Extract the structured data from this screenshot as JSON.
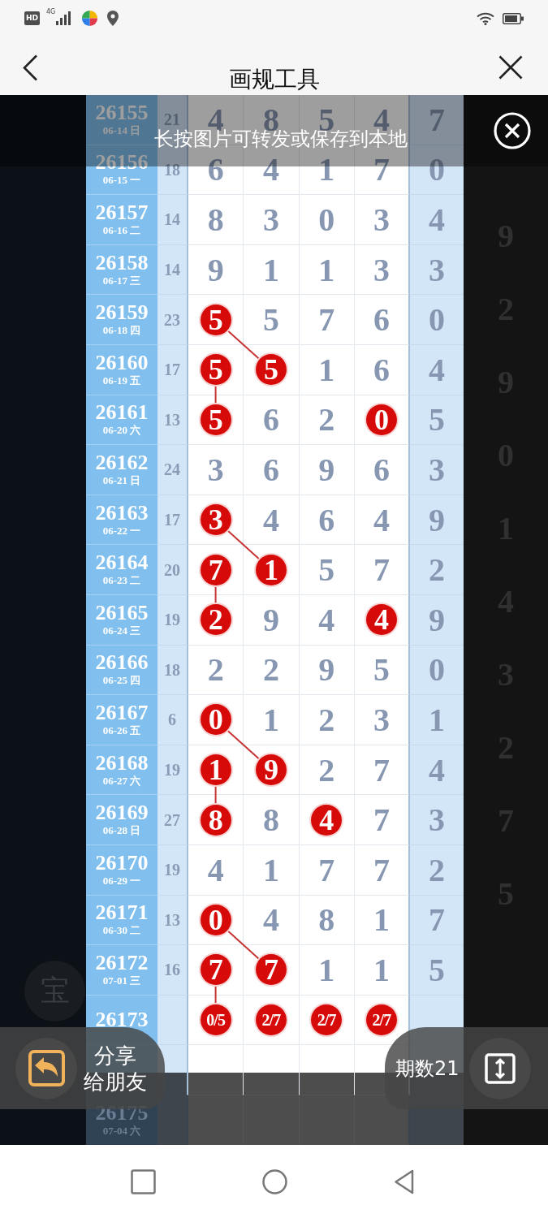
{
  "status_bar": {
    "network_badge": "HD",
    "network_type": "4G"
  },
  "header": {
    "title": "画规工具"
  },
  "banner": {
    "text": "长按图片可转发或保存到本地"
  },
  "chart_table": {
    "rows": [
      {
        "kind": "result",
        "issue": "26155",
        "date": "06-14 日",
        "column_2": "21",
        "cells": [
          {
            "value": "4",
            "marked": false
          },
          {
            "value": "8",
            "marked": false
          },
          {
            "value": "5",
            "marked": false
          },
          {
            "value": "4",
            "marked": false
          }
        ],
        "column_7": "7"
      },
      {
        "kind": "result",
        "issue": "26156",
        "date": "06-15 一",
        "column_2": "18",
        "cells": [
          {
            "value": "6",
            "marked": false
          },
          {
            "value": "4",
            "marked": false
          },
          {
            "value": "1",
            "marked": false
          },
          {
            "value": "7",
            "marked": false
          }
        ],
        "column_7": "0"
      },
      {
        "kind": "result",
        "issue": "26157",
        "date": "06-16 二",
        "column_2": "14",
        "cells": [
          {
            "value": "8",
            "marked": false
          },
          {
            "value": "3",
            "marked": false
          },
          {
            "value": "0",
            "marked": false
          },
          {
            "value": "3",
            "marked": false
          }
        ],
        "column_7": "4"
      },
      {
        "kind": "result",
        "issue": "26158",
        "date": "06-17 三",
        "column_2": "14",
        "cells": [
          {
            "value": "9",
            "marked": false
          },
          {
            "value": "1",
            "marked": false
          },
          {
            "value": "1",
            "marked": false
          },
          {
            "value": "3",
            "marked": false
          }
        ],
        "column_7": "3"
      },
      {
        "kind": "result",
        "issue": "26159",
        "date": "06-18 四",
        "column_2": "23",
        "cells": [
          {
            "value": "5",
            "marked": true,
            "connector": {
              "kind": "diagonal"
            }
          },
          {
            "value": "5",
            "marked": false
          },
          {
            "value": "7",
            "marked": false
          },
          {
            "value": "6",
            "marked": false
          }
        ],
        "column_7": "0"
      },
      {
        "kind": "result",
        "issue": "26160",
        "date": "06-19 五",
        "column_2": "17",
        "cells": [
          {
            "value": "5",
            "marked": true,
            "connector": {
              "kind": "vertical"
            }
          },
          {
            "value": "5",
            "marked": true
          },
          {
            "value": "1",
            "marked": false
          },
          {
            "value": "6",
            "marked": false
          }
        ],
        "column_7": "4"
      },
      {
        "kind": "result",
        "issue": "26161",
        "date": "06-20 六",
        "column_2": "13",
        "cells": [
          {
            "value": "5",
            "marked": true
          },
          {
            "value": "6",
            "marked": false
          },
          {
            "value": "2",
            "marked": false
          },
          {
            "value": "0",
            "marked": true
          }
        ],
        "column_7": "5"
      },
      {
        "kind": "result",
        "issue": "26162",
        "date": "06-21 日",
        "column_2": "24",
        "cells": [
          {
            "value": "3",
            "marked": false
          },
          {
            "value": "6",
            "marked": false
          },
          {
            "value": "9",
            "marked": false
          },
          {
            "value": "6",
            "marked": false
          }
        ],
        "column_7": "3"
      },
      {
        "kind": "result",
        "issue": "26163",
        "date": "06-22 一",
        "column_2": "17",
        "cells": [
          {
            "value": "3",
            "marked": true,
            "connector": {
              "kind": "diagonal"
            }
          },
          {
            "value": "4",
            "marked": false
          },
          {
            "value": "6",
            "marked": false
          },
          {
            "value": "4",
            "marked": false
          }
        ],
        "column_7": "9"
      },
      {
        "kind": "result",
        "issue": "26164",
        "date": "06-23 二",
        "column_2": "20",
        "cells": [
          {
            "value": "7",
            "marked": true,
            "connector": {
              "kind": "vertical"
            }
          },
          {
            "value": "1",
            "marked": true
          },
          {
            "value": "5",
            "marked": false
          },
          {
            "value": "7",
            "marked": false
          }
        ],
        "column_7": "2"
      },
      {
        "kind": "result",
        "issue": "26165",
        "date": "06-24 三",
        "column_2": "19",
        "cells": [
          {
            "value": "2",
            "marked": true
          },
          {
            "value": "9",
            "marked": false
          },
          {
            "value": "4",
            "marked": false
          },
          {
            "value": "4",
            "marked": true
          }
        ],
        "column_7": "9"
      },
      {
        "kind": "result",
        "issue": "26166",
        "date": "06-25 四",
        "column_2": "18",
        "cells": [
          {
            "value": "2",
            "marked": false
          },
          {
            "value": "2",
            "marked": false
          },
          {
            "value": "9",
            "marked": false
          },
          {
            "value": "5",
            "marked": false
          }
        ],
        "column_7": "0"
      },
      {
        "kind": "result",
        "issue": "26167",
        "date": "06-26 五",
        "column_2": "6",
        "cells": [
          {
            "value": "0",
            "marked": true,
            "connector": {
              "kind": "diagonal"
            }
          },
          {
            "value": "1",
            "marked": false
          },
          {
            "value": "2",
            "marked": false
          },
          {
            "value": "3",
            "marked": false
          }
        ],
        "column_7": "1"
      },
      {
        "kind": "result",
        "issue": "26168",
        "date": "06-27 六",
        "column_2": "19",
        "cells": [
          {
            "value": "1",
            "marked": true,
            "connector": {
              "kind": "vertical"
            }
          },
          {
            "value": "9",
            "marked": true
          },
          {
            "value": "2",
            "marked": false
          },
          {
            "value": "7",
            "marked": false
          }
        ],
        "column_7": "4"
      },
      {
        "kind": "result",
        "issue": "26169",
        "date": "06-28 日",
        "column_2": "27",
        "cells": [
          {
            "value": "8",
            "marked": true
          },
          {
            "value": "8",
            "marked": false
          },
          {
            "value": "4",
            "marked": true
          },
          {
            "value": "7",
            "marked": false
          }
        ],
        "column_7": "3"
      },
      {
        "kind": "result",
        "issue": "26170",
        "date": "06-29 一",
        "column_2": "19",
        "cells": [
          {
            "value": "4",
            "marked": false
          },
          {
            "value": "1",
            "marked": false
          },
          {
            "value": "7",
            "marked": false
          },
          {
            "value": "7",
            "marked": false
          }
        ],
        "column_7": "2"
      },
      {
        "kind": "result",
        "issue": "26171",
        "date": "06-30 二",
        "column_2": "13",
        "cells": [
          {
            "value": "0",
            "marked": true,
            "connector": {
              "kind": "diagonal"
            }
          },
          {
            "value": "4",
            "marked": false
          },
          {
            "value": "8",
            "marked": false
          },
          {
            "value": "1",
            "marked": false
          }
        ],
        "column_7": "7"
      },
      {
        "kind": "result",
        "issue": "26172",
        "date": "07-01 三",
        "column_2": "16",
        "cells": [
          {
            "value": "7",
            "marked": true,
            "connector": {
              "kind": "vertical"
            }
          },
          {
            "value": "7",
            "marked": true
          },
          {
            "value": "1",
            "marked": false
          },
          {
            "value": "1",
            "marked": false
          }
        ],
        "column_7": "5"
      },
      {
        "kind": "forecast",
        "issue": "26173",
        "cells": [
          {
            "value": "0/5",
            "marked": true
          },
          {
            "value": "2/7",
            "marked": true
          },
          {
            "value": "2/7",
            "marked": true
          },
          {
            "value": "2/7",
            "marked": true
          }
        ]
      },
      {
        "kind": "blank"
      },
      {
        "kind": "faded",
        "issue": "26175",
        "date": "07-04 六"
      }
    ]
  },
  "background_page": {
    "right_column": [
      "9",
      "2",
      "9",
      "0",
      "1",
      "4",
      "3",
      "2",
      "7",
      "5"
    ],
    "float_button": "宝"
  },
  "toolbar": {
    "share_label": [
      "分享",
      "给朋友"
    ],
    "count_label": "期数21"
  }
}
